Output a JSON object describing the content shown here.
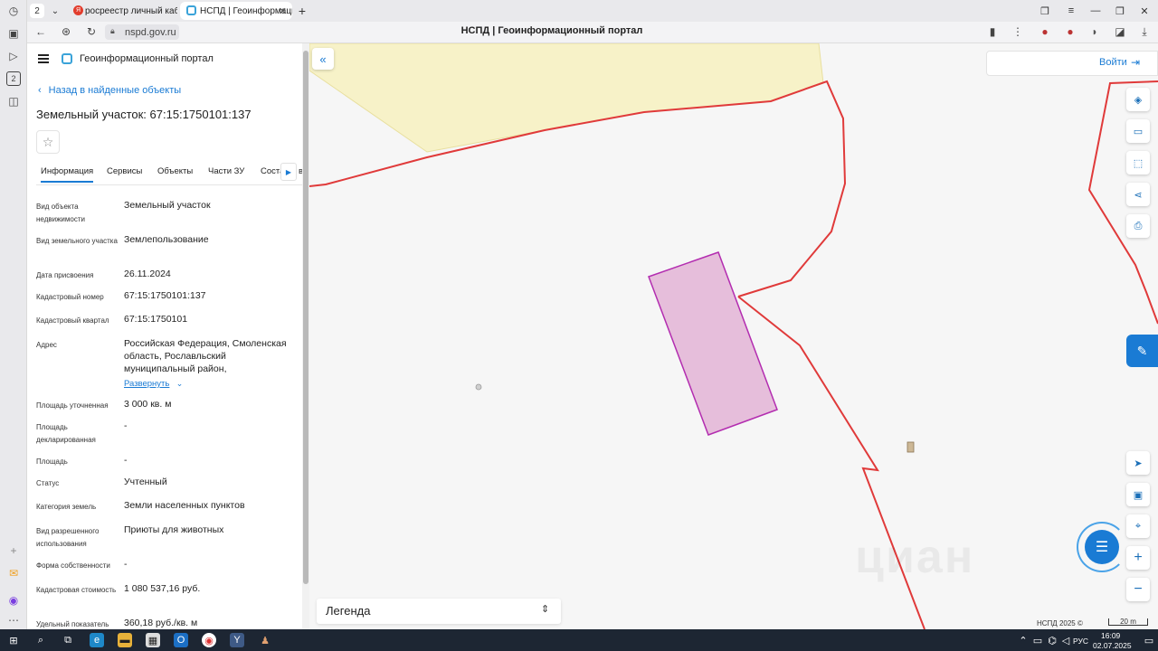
{
  "browser": {
    "tab_count_badge": "2",
    "tabs": [
      {
        "label": "росреестр личный кабин",
        "active": false
      },
      {
        "label": "НСПД | Геоинформацио",
        "active": true
      }
    ],
    "url": "nspd.gov.ru",
    "page_title": "НСПД | Геоинформационный портал"
  },
  "leftstrip": {
    "badge": "2"
  },
  "panel": {
    "portal_name": "Геоинформационный портал",
    "back_label": "Назад в найденные объекты",
    "object_title": "Земельный участок: 67:15:1750101:137",
    "tabs": [
      "Информация",
      "Сервисы",
      "Объекты",
      "Части ЗУ",
      "Соста"
    ],
    "tabs_tail": "в",
    "rows": [
      {
        "label": "Вид объекта недвижимости",
        "value": "Земельный участок"
      },
      {
        "label": "Вид земельного участка",
        "value": "Землепользование"
      },
      {
        "label": "Дата присвоения",
        "value": "26.11.2024"
      },
      {
        "label": "Кадастровый номер",
        "value": "67:15:1750101:137"
      },
      {
        "label": "Кадастровый квартал",
        "value": "67:15:1750101"
      },
      {
        "label": "Адрес",
        "value": "Российская Федерация, Смоленская область, Рославльский муниципальный район,"
      },
      {
        "label": "Площадь уточненная",
        "value": "3 000 кв. м"
      },
      {
        "label": "Площадь декларированная",
        "value": "-"
      },
      {
        "label": "Площадь",
        "value": "-"
      },
      {
        "label": "Статус",
        "value": "Учтенный"
      },
      {
        "label": "Категория земель",
        "value": "Земли населенных пунктов"
      },
      {
        "label": "Вид разрешенного использования",
        "value": "Приюты для животных"
      },
      {
        "label": "Форма собственности",
        "value": "-"
      },
      {
        "label": "Кадастровая стоимость",
        "value": "1 080 537,16 руб."
      },
      {
        "label": "Удельный показатель",
        "value": "360,18 руб./кв. м"
      }
    ],
    "expand_label": "Развернуть"
  },
  "map": {
    "login_label": "Войти",
    "legend_label": "Легенда",
    "copyright": "НСПД 2025 ©",
    "scale_label": "20 m",
    "watermark": "циан",
    "colors": {
      "boundary": "#e03a3a",
      "parcel_fill": "#e6bedb",
      "parcel_stroke": "#b32db0",
      "zone_fill": "#f7f2c8",
      "accent": "#1a7bd4"
    }
  },
  "taskbar": {
    "lang": "РУС",
    "time": "16:09",
    "date": "02.07.2025"
  }
}
